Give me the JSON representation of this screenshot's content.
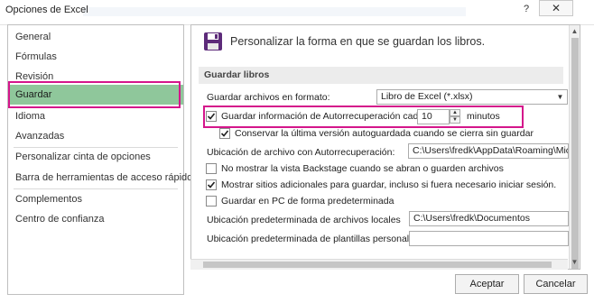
{
  "window": {
    "title": "Opciones de Excel",
    "help": "?",
    "close": "✕"
  },
  "nav": {
    "items": [
      {
        "label": "General"
      },
      {
        "label": "Fórmulas"
      },
      {
        "label": "Revisión"
      },
      {
        "label": "Guardar"
      },
      {
        "label": "Idioma"
      },
      {
        "label": "Avanzadas"
      },
      {
        "label": "Personalizar cinta de opciones"
      },
      {
        "label": "Barra de herramientas de acceso rápido"
      },
      {
        "label": "Complementos"
      },
      {
        "label": "Centro de confianza"
      }
    ],
    "selected": "Guardar"
  },
  "content": {
    "header": "Personalizar la forma en que se guardan los libros.",
    "header_icon": "floppy-disk-icon",
    "section": "Guardar libros",
    "format_label": "Guardar archivos en formato:",
    "format_value": "Libro de Excel (*.xlsx)",
    "autorecover_label": "Guardar información de Autorrecuperación cada",
    "autorecover_checked": true,
    "autorecover_minutes": "10",
    "autorecover_unit": "minutos",
    "keep_last_label": "Conservar la última versión autoguardada cuando se cierra sin guardar",
    "keep_last_checked": true,
    "autorecover_location_label": "Ubicación de archivo con Autorrecuperación:",
    "autorecover_location_value": "C:\\Users\\fredk\\AppData\\Roaming\\Micro",
    "no_backstage_label": "No mostrar la vista Backstage cuando se abran o guarden archivos",
    "no_backstage_checked": false,
    "show_places_label": "Mostrar sitios adicionales para guardar, incluso si fuera necesario iniciar sesión.",
    "show_places_checked": true,
    "save_pc_label": "Guardar en PC de forma predeterminada",
    "save_pc_checked": false,
    "local_files_label": "Ubicación predeterminada de archivos locales",
    "local_files_value": "C:\\Users\\fredk\\Documentos",
    "templates_label": "Ubicación predeterminada de plantillas personales:",
    "templates_value": ""
  },
  "buttons": {
    "ok": "Aceptar",
    "cancel": "Cancelar"
  }
}
